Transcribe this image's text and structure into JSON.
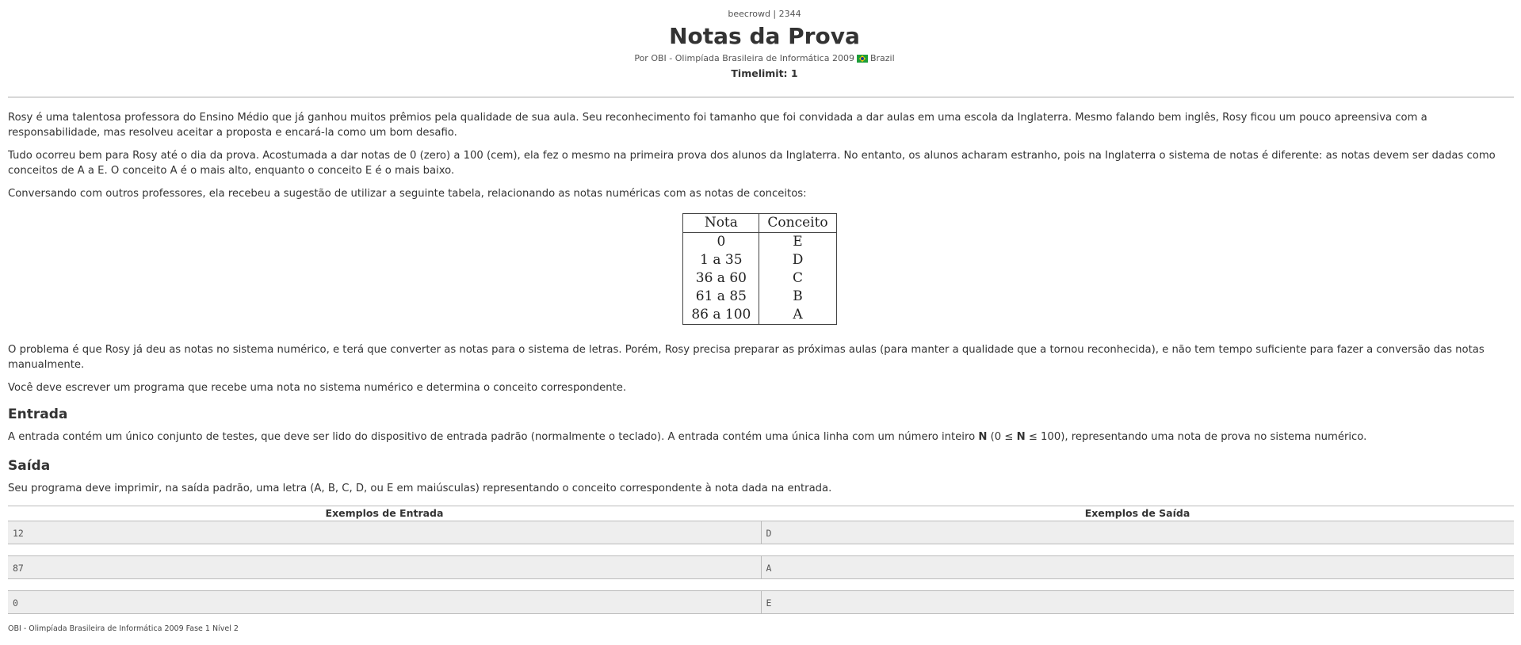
{
  "header": {
    "code": "beecrowd | 2344",
    "title": "Notas da Prova",
    "author_prefix": "Por OBI - Olimpíada Brasileira de Informática 2009",
    "country": "Brazil",
    "flag_icon": "brazil-flag-icon",
    "timelimit": "Timelimit: 1"
  },
  "description": {
    "p1": "Rosy é uma talentosa professora do Ensino Médio que já ganhou muitos prêmios pela qualidade de sua aula. Seu reconhecimento foi tamanho que foi convidada a dar aulas em uma escola da Inglaterra. Mesmo falando bem inglês, Rosy ficou um pouco apreensiva com a responsabilidade, mas resolveu aceitar a proposta e encará-la como um bom desafio.",
    "p2": "Tudo ocorreu bem para Rosy até o dia da prova. Acostumada a dar notas de 0 (zero) a 100 (cem), ela fez o mesmo na primeira prova dos alunos da Inglaterra. No entanto, os alunos acharam estranho, pois na Inglaterra o sistema de notas é diferente: as notas devem ser dadas como conceitos de A a E. O conceito A é o mais alto, enquanto o conceito E é o mais baixo.",
    "p3": "Conversando com outros professores, ela recebeu a sugestão de utilizar a seguinte tabela, relacionando as notas numéricas com as notas de conceitos:",
    "p4": "O problema é que Rosy já deu as notas no sistema numérico, e terá que converter as notas para o sistema de letras. Porém, Rosy precisa preparar as próximas aulas (para manter a qualidade que a tornou reconhecida), e não tem tempo suficiente para fazer a conversão das notas manualmente.",
    "p5": "Você deve escrever um programa que recebe uma nota no sistema numérico e determina o conceito correspondente."
  },
  "grade_table": {
    "headers": [
      "Nota",
      "Conceito"
    ],
    "rows": [
      {
        "nota": "0",
        "conceito": "E"
      },
      {
        "nota": "1 a 35",
        "conceito": "D"
      },
      {
        "nota": "36 a 60",
        "conceito": "C"
      },
      {
        "nota": "61 a 85",
        "conceito": "B"
      },
      {
        "nota": "86 a 100",
        "conceito": "A"
      }
    ]
  },
  "entrada": {
    "title": "Entrada",
    "text_before": "A entrada contém um único conjunto de testes, que deve ser lido do dispositivo de entrada padrão (normalmente o teclado). A entrada contém uma única linha com um número inteiro ",
    "var_n": "N",
    "text_range_open": " (0 ≤ ",
    "var_n2": "N",
    "text_after": " ≤ 100), representando uma nota de prova no sistema numérico."
  },
  "saida": {
    "title": "Saída",
    "text": "Seu programa deve imprimir, na saída padrão, uma letra (A, B, C, D, ou E em maiúsculas) representando o conceito correspondente à nota dada na entrada."
  },
  "examples": {
    "input_header": "Exemplos de Entrada",
    "output_header": "Exemplos de Saída",
    "rows": [
      {
        "input": "12",
        "output": "D"
      },
      {
        "input": "87",
        "output": "A"
      },
      {
        "input": "0",
        "output": "E"
      }
    ]
  },
  "footer": {
    "source": "OBI - Olimpíada Brasileira de Informática 2009 Fase 1 Nível 2"
  }
}
